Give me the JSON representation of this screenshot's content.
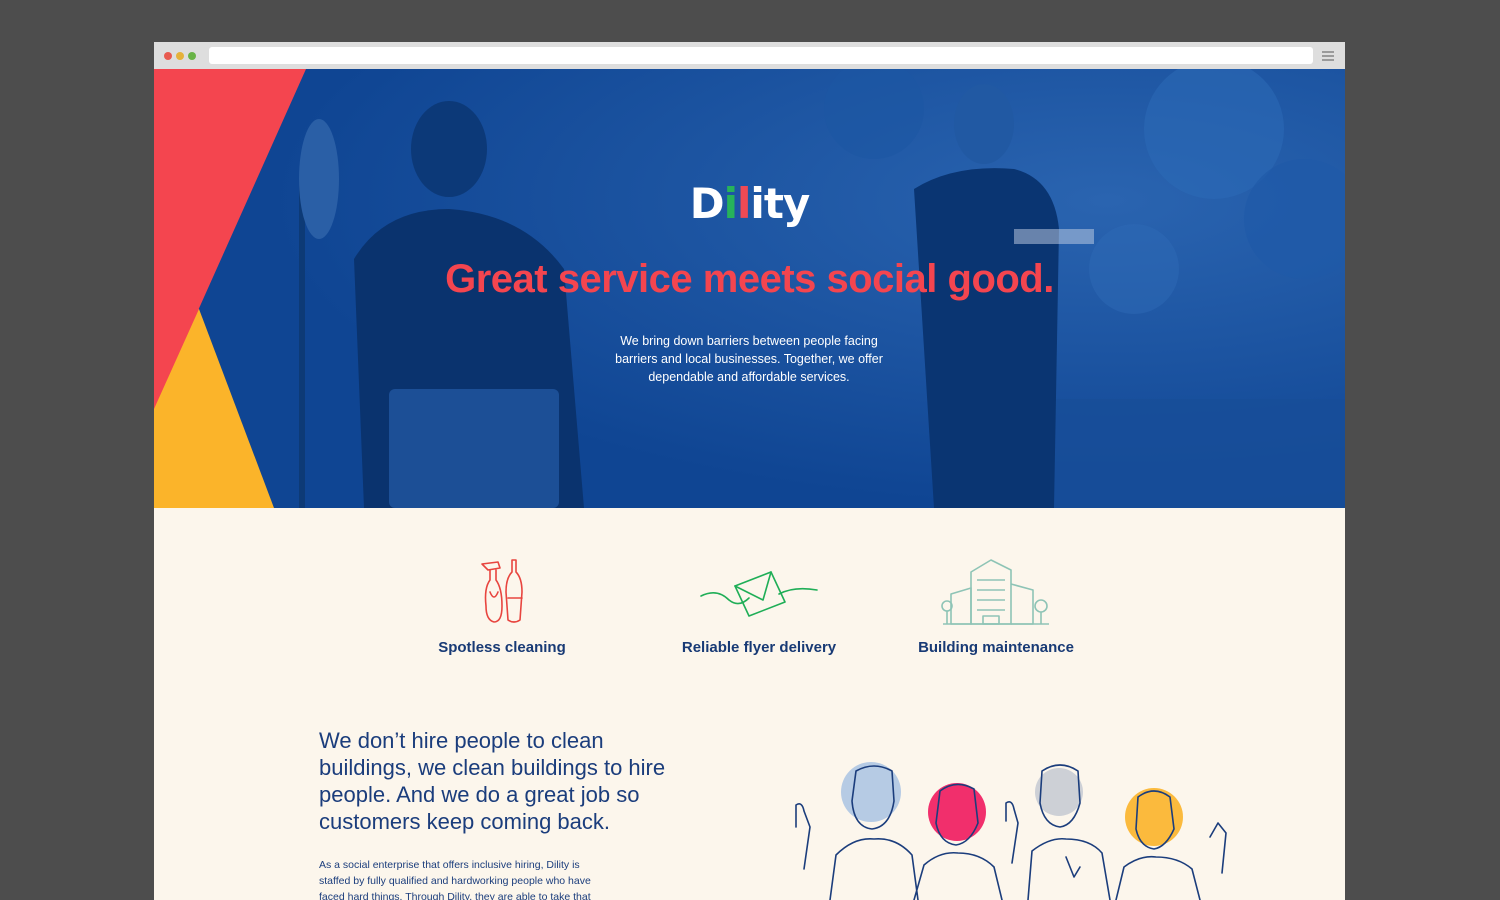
{
  "browser": {
    "url": ""
  },
  "hero": {
    "logo": {
      "part1": "D",
      "part2": "i",
      "part3": "l",
      "part4": "i",
      "part5": "ty"
    },
    "headline": "Great service meets social good.",
    "subtext": "We bring down barriers between people facing barriers and local businesses. Together, we offer dependable and affordable services.",
    "colors": {
      "background": "#114a98",
      "accent_red": "#f4454f",
      "accent_yellow": "#fbb42a",
      "accent_green": "#27b35a"
    }
  },
  "services": [
    {
      "label": "Spotless cleaning",
      "icon": "cleaning-bottles-icon"
    },
    {
      "label": "Reliable flyer delivery",
      "icon": "envelope-icon"
    },
    {
      "label": "Building maintenance",
      "icon": "building-icon"
    }
  ],
  "mission": {
    "statement": "We don’t hire people to clean buildings, we clean buildings to hire people. And we do a great job so customers keep coming back.",
    "body": "As a social enterprise that offers inclusive hiring, Dility is staffed by fully qualified and hardworking people who have faced hard things. Through Dility, they are able to take that"
  }
}
